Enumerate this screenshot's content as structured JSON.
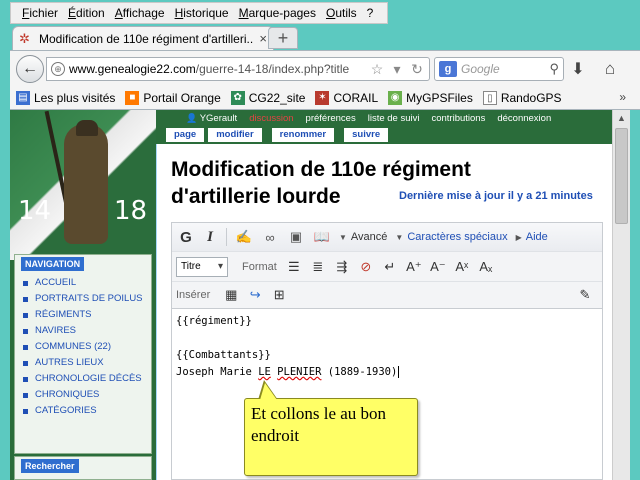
{
  "menu": [
    "Fichier",
    "Édition",
    "Affichage",
    "Historique",
    "Marque-pages",
    "Outils",
    "?"
  ],
  "tab": {
    "title": "Modification de 110e régiment d'artilleri...",
    "close": "×",
    "new_tab": "+"
  },
  "nav": {
    "url_host": "www.genealogie22.com",
    "url_path": "/guerre-14-18/index.php?title",
    "search_placeholder": "Google",
    "search_engine": "g"
  },
  "bookmarks": [
    "Les plus visités",
    "Portail Orange",
    "CG22_site",
    "CORAIL",
    "MyGPSFiles",
    "RandoGPS"
  ],
  "bookmarks_more": "»",
  "wiki": {
    "user_links": [
      "YGerault",
      "discussion",
      "préférences",
      "liste de suivi",
      "contributions",
      "déconnexion"
    ],
    "tabs": [
      "page",
      "modifier",
      "renommer",
      "suivre"
    ],
    "banner_left": "14",
    "banner_right": "18",
    "nav_header": "NAVIGATION",
    "nav_items": [
      "ACCUEIL",
      "PORTRAITS DE POILUS",
      "RÉGIMENTS",
      "NAVIRES",
      "COMMUNES (22)",
      "AUTRES LIEUX",
      "CHRONOLOGIE DÉCÈS",
      "CHRONIQUES",
      "CATÉGORIES"
    ],
    "search_header": "Rechercher",
    "heading": "Modification de 110e régiment d'artillerie lourde",
    "last_update": "Dernière mise à jour il y a 21 minutes"
  },
  "editor": {
    "toolbar1": {
      "bold": "G",
      "italic": "I",
      "advanced": "Avancé",
      "special_chars": "Caractères spéciaux",
      "help": "Aide"
    },
    "toolbar2": {
      "heading_select": "Titre",
      "format_label": "Format"
    },
    "toolbar3": {
      "insert_label": "Insérer"
    },
    "lines": [
      "{{régiment}}",
      "",
      "{{Combattants}}",
      "Joseph Marie LE PLENIER (1889-1930)"
    ],
    "last_line_parts": [
      "Joseph Marie ",
      "LE",
      " ",
      "PLENIER",
      " (1889-1930)"
    ]
  },
  "callout": {
    "text": "Et collons le au bon endroit"
  },
  "colors": {
    "desktop": "#5cc9c0",
    "wiki_green": "#2a6c3a",
    "link_blue": "#1f4fb5",
    "callout_yellow": "#ffff66"
  }
}
